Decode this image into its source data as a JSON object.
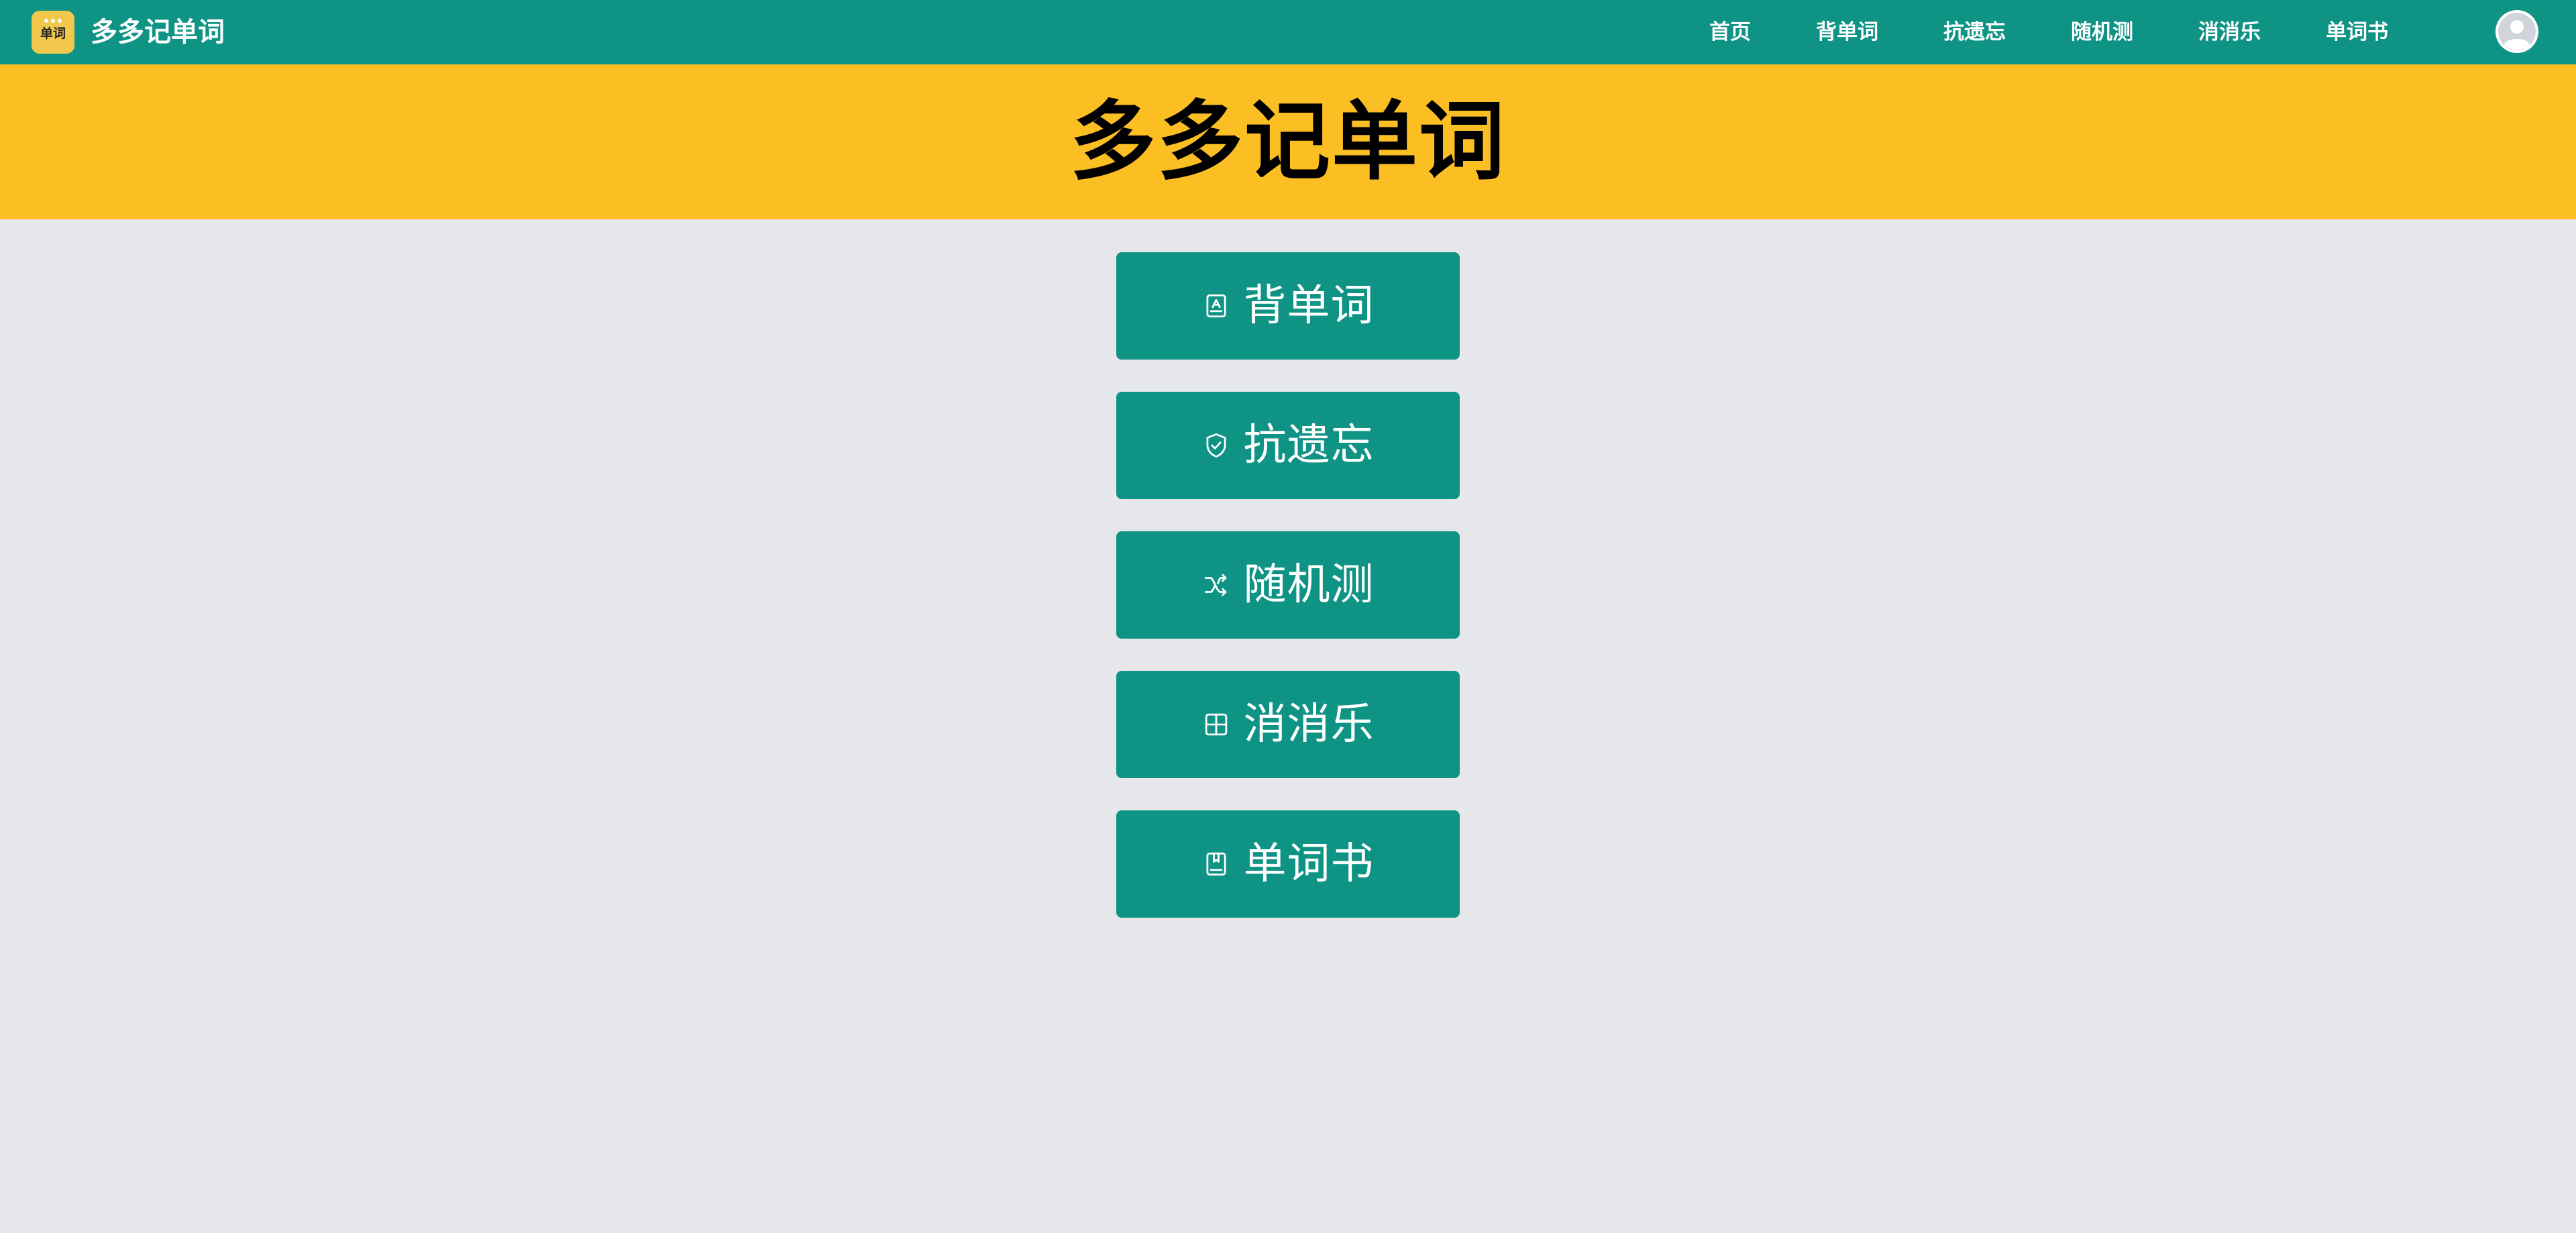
{
  "header": {
    "logo_text": "单词",
    "brand_name": "多多记单词",
    "nav": [
      {
        "label": "首页"
      },
      {
        "label": "背单词"
      },
      {
        "label": "抗遗忘"
      },
      {
        "label": "随机测"
      },
      {
        "label": "消消乐"
      },
      {
        "label": "单词书"
      }
    ],
    "avatar_icon": "user-avatar-icon"
  },
  "banner": {
    "title": "多多记单词"
  },
  "menu": {
    "buttons": [
      {
        "label": "背单词",
        "icon": "book-icon"
      },
      {
        "label": "抗遗忘",
        "icon": "shield-check-icon"
      },
      {
        "label": "随机测",
        "icon": "shuffle-icon"
      },
      {
        "label": "消消乐",
        "icon": "grid-icon"
      },
      {
        "label": "单词书",
        "icon": "bookmark-book-icon"
      }
    ]
  },
  "colors": {
    "primary": "#0E9384",
    "banner": "#FBBF24",
    "background": "#E6E7EB",
    "logo": "#F1C84B"
  }
}
